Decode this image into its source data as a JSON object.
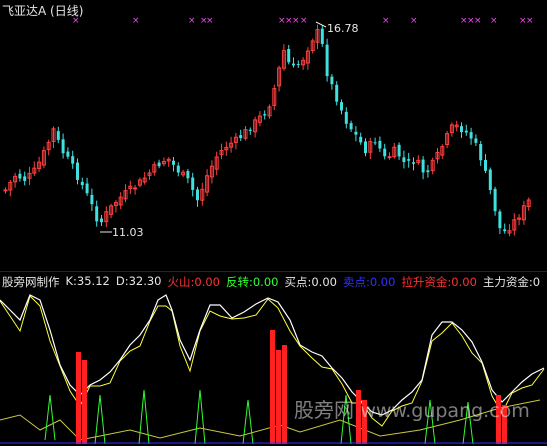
{
  "header": {
    "stock_title": "飞亚达A",
    "period": "(日线)"
  },
  "price_annotations": {
    "high": "16.78",
    "low": "11.03"
  },
  "indicator": {
    "name": "股旁网制作",
    "items": [
      {
        "label": "K:35.12",
        "color": "#e6e6e6"
      },
      {
        "label": "D:32.30",
        "color": "#e6e6e6"
      },
      {
        "label": "火山:0.00",
        "color": "#ff3030"
      },
      {
        "label": "反转:0.00",
        "color": "#30ff30"
      },
      {
        "label": "买点:0.00",
        "color": "#e6e6e6"
      },
      {
        "label": "卖点:0.00",
        "color": "#3030ff"
      },
      {
        "label": "拉升资金:0.00",
        "color": "#ff3030"
      },
      {
        "label": "主力资金:0",
        "color": "#e6e6e6"
      }
    ]
  },
  "watermark": {
    "cn": "股旁网",
    "url": "www.gupang.com"
  },
  "colors": {
    "up": "#ff4040",
    "down": "#40e0e0",
    "marker": "#ff40ff",
    "k_line": "#ffffff",
    "d_line": "#ffff40",
    "volcano": "#ff2020",
    "reverse": "#30ff30"
  }
}
